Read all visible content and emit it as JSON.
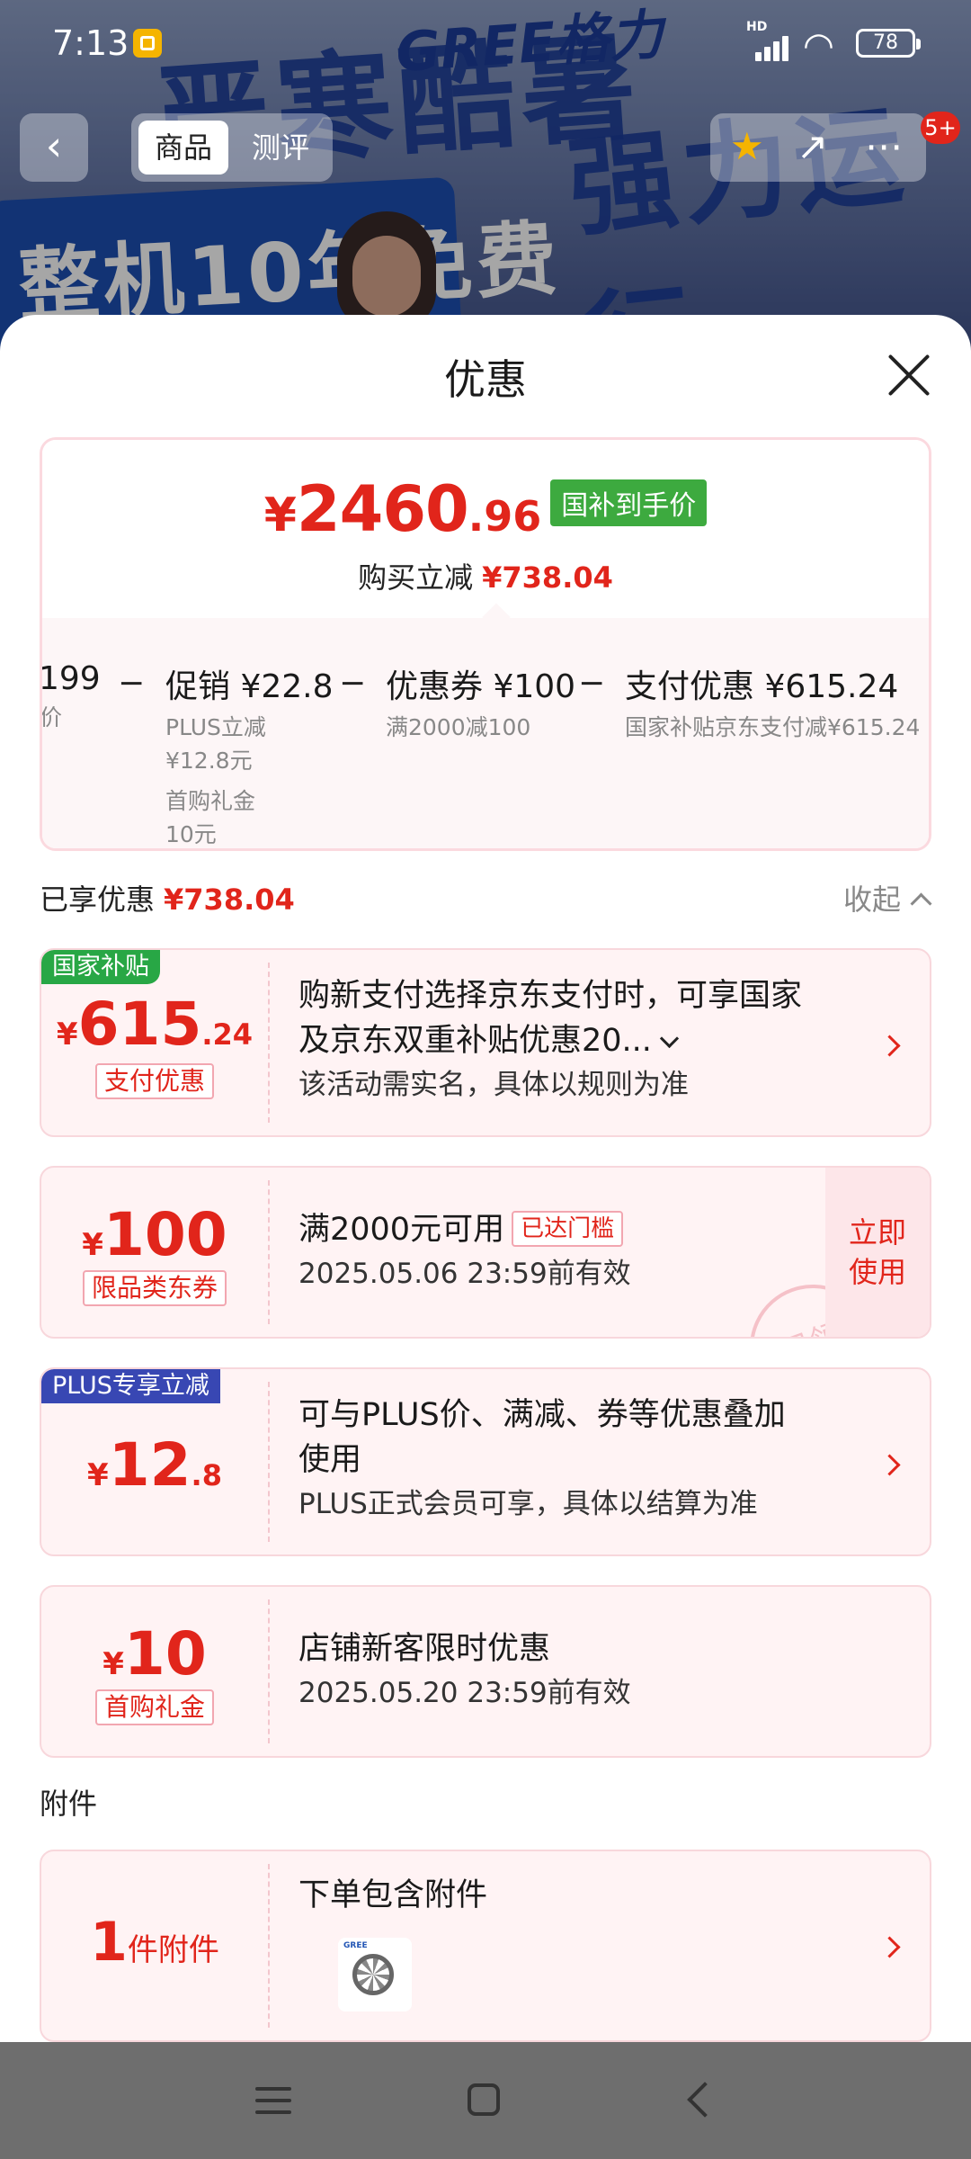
{
  "status_bar": {
    "time": "7:13",
    "signal": "HD",
    "battery": "78"
  },
  "background": {
    "slogan_1": "严寒酷暑",
    "slogan_2": "强力运行",
    "brand": "GREE格力",
    "box_text": "整机10年免费"
  },
  "nav": {
    "back": "‹",
    "tabs": [
      "商品",
      "测评"
    ],
    "icons": [
      "star-icon",
      "share-icon",
      "more-icon"
    ],
    "badge": "5+"
  },
  "sheet": {
    "title": "优惠",
    "summary": {
      "price_yen": "¥",
      "price_int": "2460",
      "price_dec": ".96",
      "price_tag": "国补到手价",
      "reduce_label": "购买立减",
      "reduce_amount": "¥738.04",
      "breakdown": [
        {
          "title": "199",
          "sub": [
            "东价"
          ]
        },
        {
          "title": "促销 ¥22.8",
          "sub": [
            "PLUS立减",
            "¥12.8元",
            "首购礼金",
            "10元"
          ]
        },
        {
          "title": "优惠券 ¥100",
          "sub": [
            "满2000减100"
          ]
        },
        {
          "title": "支付优惠 ¥615.24",
          "sub": [
            "国家补贴京东支付减¥615.24"
          ]
        }
      ],
      "operator": "−"
    },
    "enjoyed": {
      "label": "已享优惠",
      "amount": "¥738.04",
      "collapse": "收起"
    },
    "coupons": [
      {
        "corner": "国家补贴",
        "yen": "¥",
        "int": "615",
        "dec": ".24",
        "tag": "支付优惠",
        "line1": "购新支付选择京东支付时，可享国家",
        "line1b": "及京东双重补贴优惠20...",
        "line2": "该活动需实名，具体以规则为准"
      },
      {
        "yen": "¥",
        "int": "100",
        "tag": "限品类东券",
        "line1": "满2000元可用",
        "mini_tag": "已达门槛",
        "line2": "2025.05.06 23:59前有效",
        "button": [
          "立即",
          "使用"
        ],
        "stamp": "已领"
      },
      {
        "corner": "PLUS专享立减",
        "yen": "¥",
        "int": "12",
        "dec": ".8",
        "line1": "可与PLUS价、满减、券等优惠叠加",
        "line1b": "使用",
        "line2": "PLUS正式会员可享，具体以结算为准"
      },
      {
        "yen": "¥",
        "int": "10",
        "tag": "首购礼金",
        "line1": "店铺新客限时优惠",
        "line2": "2025.05.20 23:59前有效"
      }
    ],
    "accessory": {
      "section": "附件",
      "count": "1",
      "unit": "件附件",
      "title": "下单包含附件",
      "thumb_brand": "GREE"
    }
  },
  "navbar": {
    "icons": [
      "menu-icon",
      "home-icon",
      "back-icon"
    ]
  }
}
